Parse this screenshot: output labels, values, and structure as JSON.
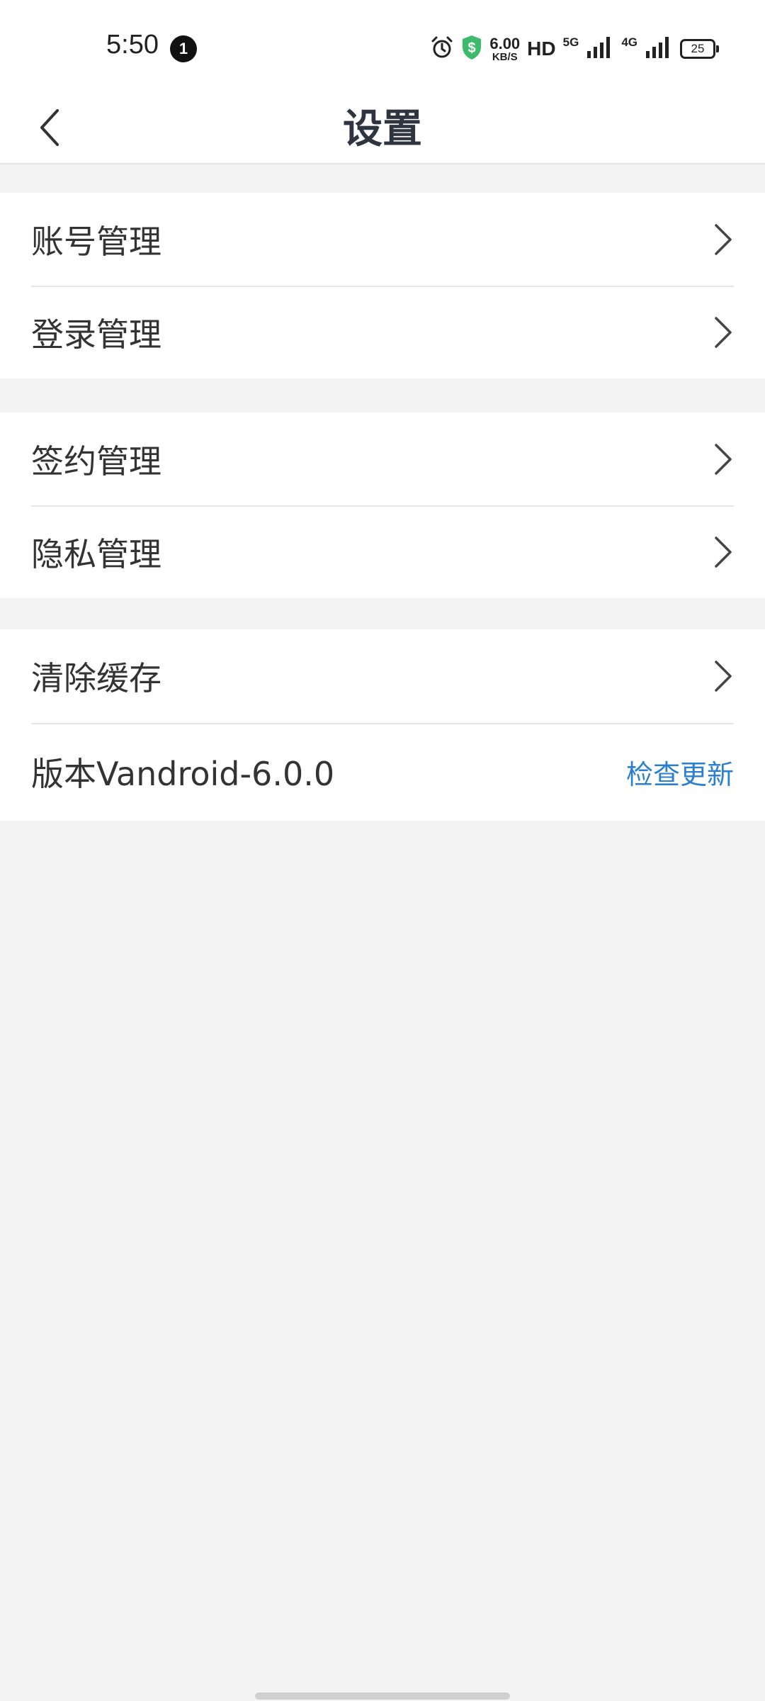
{
  "status_bar": {
    "time": "5:50",
    "notification_count": "1",
    "net_speed_value": "6.00",
    "net_speed_unit": "KB/S",
    "hd_label": "HD",
    "network_5g": "5G",
    "network_4g": "4G",
    "battery": "25",
    "icons": [
      "alarm-icon",
      "shield-icon",
      "signal-5g-icon",
      "signal-4g-icon",
      "battery-icon"
    ],
    "shield_color": "#3dbb6a"
  },
  "header": {
    "title": "设置",
    "back_icon": "chevron-left-icon"
  },
  "groups": [
    {
      "items": [
        {
          "label": "账号管理"
        },
        {
          "label": "登录管理"
        }
      ]
    },
    {
      "items": [
        {
          "label": "签约管理"
        },
        {
          "label": "隐私管理"
        }
      ]
    },
    {
      "items": [
        {
          "label": "清除缓存"
        },
        {
          "label": "版本Vandroid-6.0.0",
          "action": "检查更新"
        }
      ]
    }
  ],
  "colors": {
    "accent": "#2b7fd0",
    "page_background": "#f4f4f4"
  }
}
